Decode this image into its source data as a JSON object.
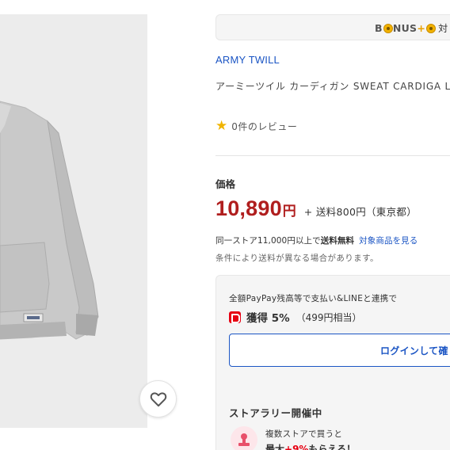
{
  "product": {
    "brand": "ARMY TWILL",
    "name": "アーミーツイル カーディガン SWEAT CARDIGA LL",
    "review_count_label": "0件のレビュー",
    "image_alt": "gray sweat cardigan"
  },
  "bonus_banner": {
    "logo_text": "B",
    "logo_rest": "NUS",
    "logo_plus": "+",
    "suffix": "対"
  },
  "price": {
    "label": "価格",
    "value": "10,890",
    "currency": "円",
    "shipping": "+ 送料800円（東京都）"
  },
  "shipping_note": {
    "free_prefix": "同一ストア11,000円以上で",
    "free_bold": "送料無料",
    "target_link": "対象商品を見る",
    "condition": "条件により送料が異なる場合があります。"
  },
  "points": {
    "description": "全額PayPay残高等で支払い&LINEと連携で",
    "earn": "獲得 5%",
    "equivalent": "（499円相当）",
    "login_label": "ログインして確"
  },
  "rally": {
    "title": "ストアラリー開催中",
    "line1": "複数ストアで買うと",
    "line2_prefix": "最大",
    "line2_accent": "+9%",
    "line2_suffix": "もらえる！"
  },
  "icons": {
    "favorite": "heart-outline-icon",
    "rating": "star-icon",
    "paypay": "paypay-icon",
    "rally": "stamp-icon"
  },
  "colors": {
    "brand_link": "#1b55c4",
    "price": "#b01e1e",
    "star": "#f0b400",
    "paypay": "#e60012"
  }
}
